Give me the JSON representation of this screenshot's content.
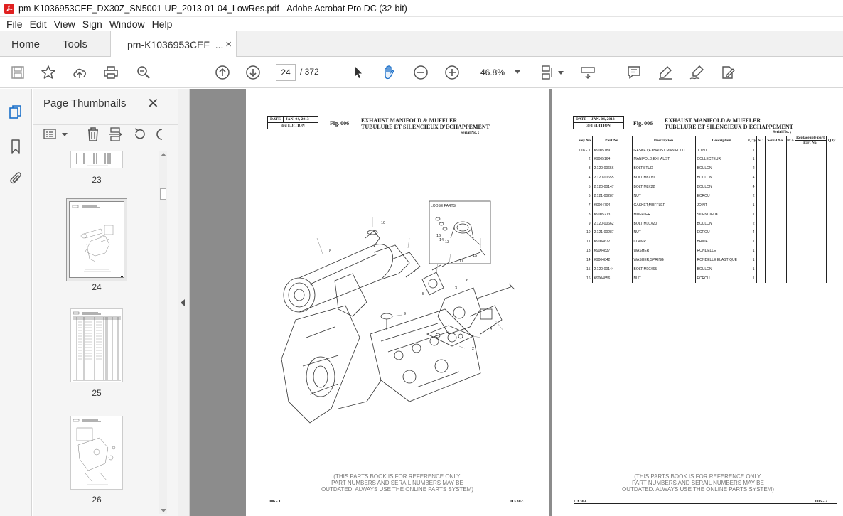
{
  "window": {
    "title": "pm-K1036953CEF_DX30Z_SN5001-UP_2013-01-04_LowRes.pdf - Adobe Acrobat Pro DC (32-bit)"
  },
  "menu": [
    "File",
    "Edit",
    "View",
    "Sign",
    "Window",
    "Help"
  ],
  "tabs": {
    "home": "Home",
    "tools": "Tools",
    "document": "pm-K1036953CEF_...",
    "close_glyph": "×"
  },
  "toolbar": {
    "current_page": "24",
    "page_total": "/ 372",
    "zoom": "46.8%"
  },
  "thumbnails_panel": {
    "title": "Page Thumbnails",
    "close_glyph": "✕",
    "pages": [
      "23",
      "24",
      "25",
      "26"
    ],
    "selected_page": "24"
  },
  "page_left": {
    "date_label": "DATE",
    "date_value": "JAN. 04, 2013",
    "edition": "3rd EDITION",
    "fig": "Fig. 006",
    "title_en": "EXHAUST MANIFOLD & MUFFLER",
    "title_fr": "TUBULURE ET SILENCIEUX D'ECHAPPEMENT",
    "serial": "Serial No. ;",
    "loose_parts": "LOOSE PARTS",
    "callouts": [
      "10",
      "8",
      "7",
      "3",
      "6",
      "9",
      "5",
      "4",
      "1",
      "2",
      "16",
      "14",
      "13",
      "15",
      "11"
    ],
    "footer_note": [
      "(THIS PARTS BOOK IS FOR REFERENCE ONLY.",
      "PART NUMBERS AND SERAIL NUMBERS MAY BE",
      "OUTDATED. ALWAYS USE THE ONLINE PARTS SYSTEM)"
    ],
    "footer_left": "006 - 1",
    "footer_right": "DX30Z"
  },
  "page_right": {
    "date_label": "DATE",
    "date_value": "JAN. 04, 2013",
    "edition": "3rd EDITION",
    "fig": "Fig. 006",
    "title_en": "EXHAUST MANIFOLD & MUFFLER",
    "title_fr": "TUBULURE ET SILENCIEUX D'ECHAPPEMENT",
    "serial": "Serial No. ;",
    "columns": {
      "key_no": "Key No.",
      "part_no": "Part No.",
      "desc_en": "Description",
      "desc_fr": "Description",
      "qty": "Q'ty",
      "sc": "SC",
      "serial_no": "Serial No.",
      "ica": "ICA",
      "replaceable": "Replaceable part",
      "rep_part_no": "Part No.",
      "rep_qty": "Q'ty"
    },
    "rows": [
      [
        "006 - 1",
        "K9005189",
        "GASKET;EXHAUST MANIFOLD",
        "JOINT",
        "1"
      ],
      [
        "2",
        "K9005164",
        "MANIFOLD;EXHAUST",
        "COLLECTEUR",
        "1"
      ],
      [
        "3",
        "2.120-00656",
        "BOLT;STUD",
        "BOULON",
        "2"
      ],
      [
        "4",
        "2.120-00655",
        "BOLT M8X80",
        "BOULON",
        "4"
      ],
      [
        "5",
        "2.120-00147",
        "BOLT M8X22",
        "BOULON",
        "4"
      ],
      [
        "6",
        "2.121-00287",
        "NUT",
        "ECROU",
        "2"
      ],
      [
        "7",
        "K9004704",
        "GASKET;MUFFLER",
        "JOINT",
        "1"
      ],
      [
        "8",
        "K9005213",
        "MUFFLER",
        "SILENCIEUX",
        "1"
      ],
      [
        "9",
        "2.120-00662",
        "BOLT M10X20",
        "BOULON",
        "2"
      ],
      [
        "10",
        "2.121-00287",
        "NUT",
        "ECROU",
        "4"
      ],
      [
        "11",
        "K9004672",
        "CLAMP",
        "BRIDE",
        "1"
      ],
      [
        "13",
        "K9004837",
        "WASHER",
        "RONDELLE",
        "1"
      ],
      [
        "14",
        "K9004842",
        "WASHER;SPRING",
        "RONDELLE ELASTIQUE",
        "1"
      ],
      [
        "15",
        "2.120-00144",
        "BOLT M10X65",
        "BOULON",
        "1"
      ],
      [
        "16",
        "K9004856",
        "NUT",
        "ECROU",
        "1"
      ]
    ],
    "footer_note": [
      "(THIS PARTS BOOK IS FOR REFERENCE ONLY.",
      "PART NUMBERS AND SERAIL NUMBERS MAY BE",
      "OUTDATED. ALWAYS USE THE ONLINE PARTS SYSTEM)"
    ],
    "footer_left": "DX30Z",
    "footer_right": "006 - 2"
  },
  "colors": {
    "acrobat_red": "#e02020",
    "doc_background": "#8c8c8c",
    "panel_background": "#f5f5f5"
  }
}
